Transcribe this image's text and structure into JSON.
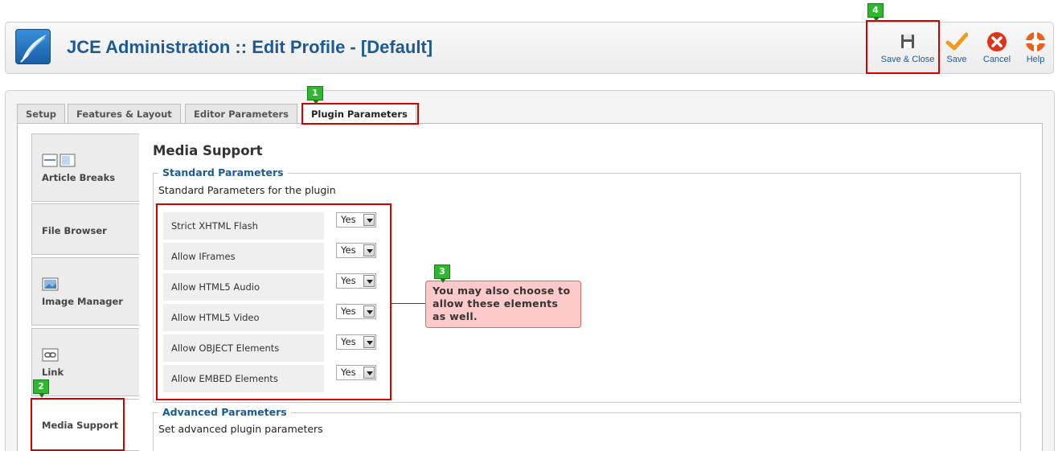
{
  "header": {
    "title": "JCE Administration :: Edit Profile - [Default]",
    "toolbar": {
      "save_close_label": "Save & Close",
      "save_label": "Save",
      "cancel_label": "Cancel",
      "help_label": "Help"
    }
  },
  "tabs": [
    {
      "label": "Setup",
      "active": false
    },
    {
      "label": "Features & Layout",
      "active": false
    },
    {
      "label": "Editor Parameters",
      "active": false
    },
    {
      "label": "Plugin Parameters",
      "active": true
    }
  ],
  "plugins": [
    {
      "label": "Article Breaks",
      "icon": "article-breaks-icon",
      "active": false
    },
    {
      "label": "File Browser",
      "icon": "",
      "active": false
    },
    {
      "label": "Image Manager",
      "icon": "image-manager-icon",
      "active": false
    },
    {
      "label": "Link",
      "icon": "link-icon",
      "active": false
    },
    {
      "label": "Media Support",
      "icon": "",
      "active": true
    }
  ],
  "panel": {
    "title": "Media Support",
    "standard": {
      "legend": "Standard Parameters",
      "description": "Standard Parameters for the plugin",
      "params": [
        {
          "label": "Strict XHTML Flash",
          "value": "Yes"
        },
        {
          "label": "Allow IFrames",
          "value": "Yes"
        },
        {
          "label": "Allow HTML5 Audio",
          "value": "Yes"
        },
        {
          "label": "Allow HTML5 Video",
          "value": "Yes"
        },
        {
          "label": "Allow OBJECT Elements",
          "value": "Yes"
        },
        {
          "label": "Allow EMBED Elements",
          "value": "Yes"
        }
      ]
    },
    "advanced": {
      "legend": "Advanced Parameters",
      "description": "Set advanced plugin parameters"
    }
  },
  "annotations": {
    "badges": [
      "1",
      "2",
      "3",
      "4"
    ],
    "callout_text": "You may also choose to allow these elements as well.",
    "highlight_color": "#d40000",
    "badge_color": "#2eb82e"
  }
}
